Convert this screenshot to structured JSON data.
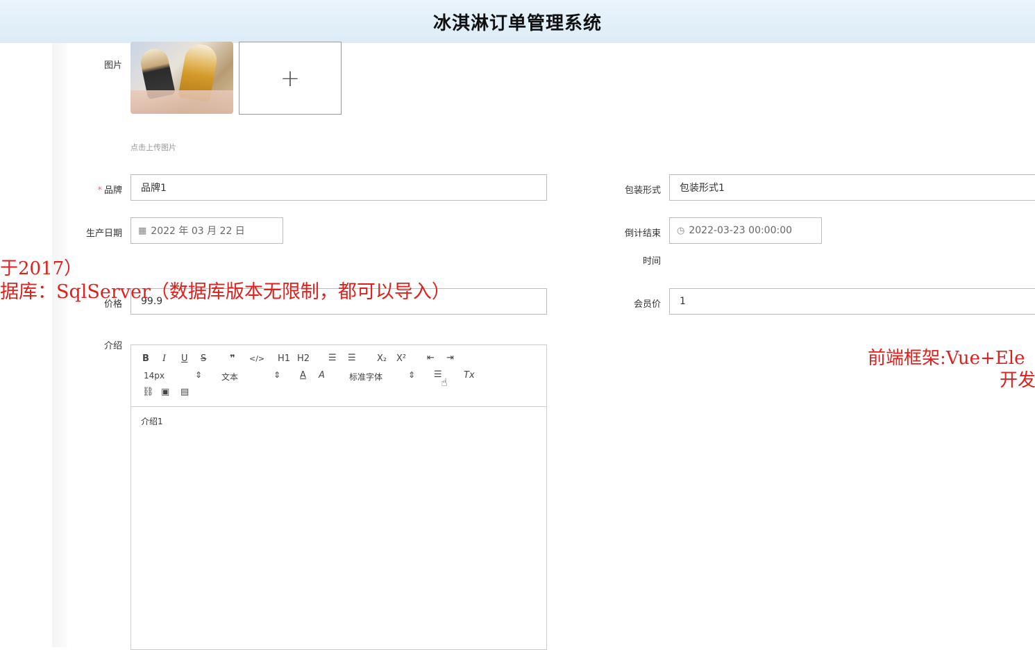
{
  "header": {
    "title": "冰淇淋订单管理系统"
  },
  "form": {
    "image": {
      "label": "图片",
      "add_symbol": "+",
      "hint": "点击上传图片"
    },
    "brand": {
      "label": "品牌",
      "value": "品牌1",
      "required": true,
      "required_mark": "*"
    },
    "packaging": {
      "label": "包装形式",
      "value": "包装形式1"
    },
    "production_date": {
      "label": "生产日期",
      "value": "2022 年 03 月 22 日",
      "icon": "calendar-icon"
    },
    "countdown_end": {
      "label_line1": "倒计结束",
      "label_line2": "时间",
      "value": "2022-03-23 00:00:00",
      "icon": "clock-icon"
    },
    "price": {
      "label": "价格",
      "value": "99.9"
    },
    "member_price": {
      "label": "会员价",
      "value": "1"
    },
    "intro": {
      "label": "介绍",
      "toolbar": {
        "bold": "B",
        "italic": "I",
        "underline": "U",
        "strike": "S",
        "blockquote": "❞",
        "code": "</>",
        "h1": "H1",
        "h2": "H2",
        "font_size": "14px",
        "block_type": "文本",
        "font_family": "标准字体",
        "subscript": "X₂",
        "superscript": "X²",
        "text_color": "A",
        "bg_color": "A",
        "clear_format": "Tx"
      },
      "content": "介绍1"
    }
  },
  "overlay": {
    "line_a": "于2017）",
    "line_b": "据库：SqlServer（数据库版本无限制，都可以导入）",
    "line_c": "前端框架:Vue+Ele",
    "line_d": "开发"
  },
  "colors": {
    "header_bg": "#dcecf7",
    "required": "#f56c6c",
    "overlay_red": "#e0201c"
  }
}
